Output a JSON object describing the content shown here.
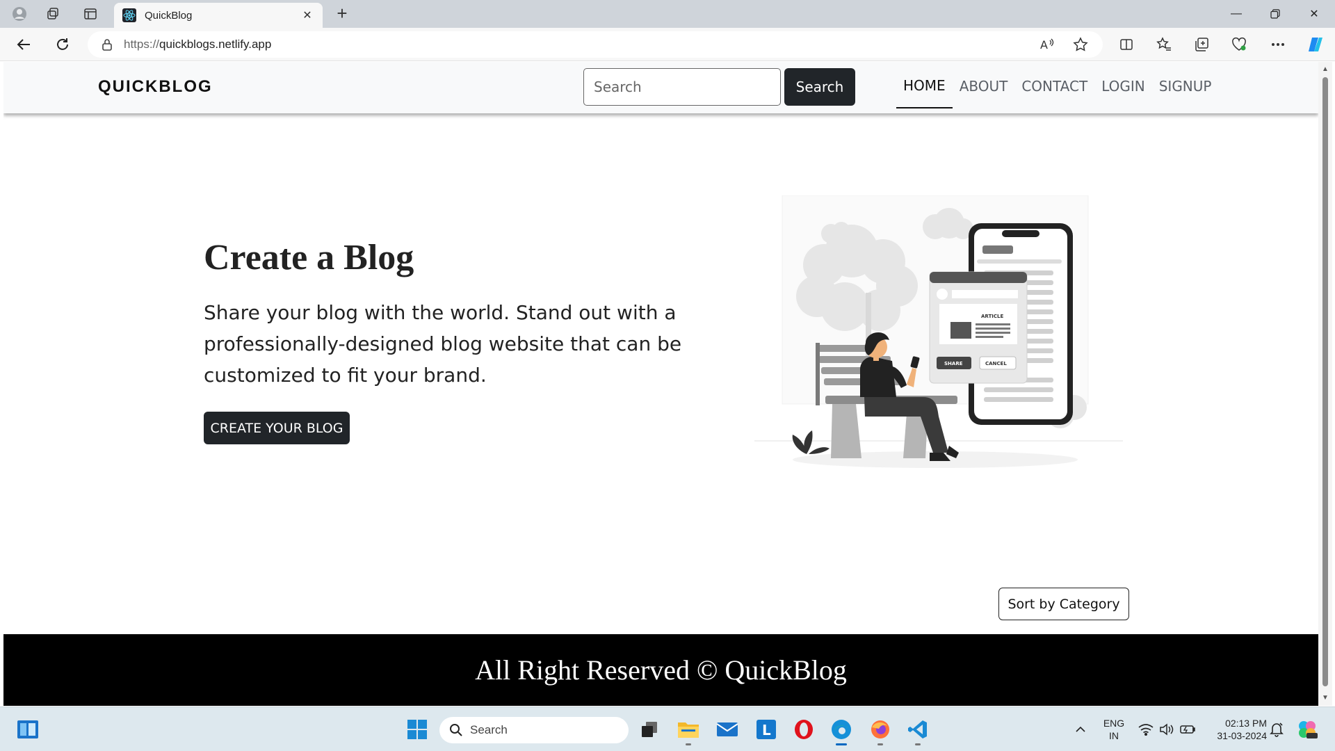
{
  "browser": {
    "tab_title": "QuickBlog",
    "url_protocol": "https://",
    "url_host": "quickblogs.netlify.app"
  },
  "site": {
    "brand": "QUICKBLOG",
    "search_placeholder": "Search",
    "search_button": "Search",
    "nav": [
      "HOME",
      "ABOUT",
      "CONTACT",
      "LOGIN",
      "SIGNUP"
    ],
    "active_nav": "HOME"
  },
  "hero": {
    "title": "Create a Blog",
    "text": "Share your blog with the world. Stand out with a professionally-designed blog website that can be customized to fit your brand.",
    "button": "CREATE YOUR BLOG",
    "illustration": {
      "article_label": "ARTICLE",
      "share_label": "SHARE",
      "cancel_label": "CANCEL"
    }
  },
  "sort_button": "Sort by Category",
  "footer": "All Right Reserved © QuickBlog",
  "taskbar": {
    "search_label": "Search",
    "lang_line1": "ENG",
    "lang_line2": "IN",
    "time": "02:13 PM",
    "date": "31-03-2024"
  },
  "colors": {
    "dark_button": "#212529",
    "footer_bg": "#000000",
    "header_bg": "#f8f9fa"
  }
}
